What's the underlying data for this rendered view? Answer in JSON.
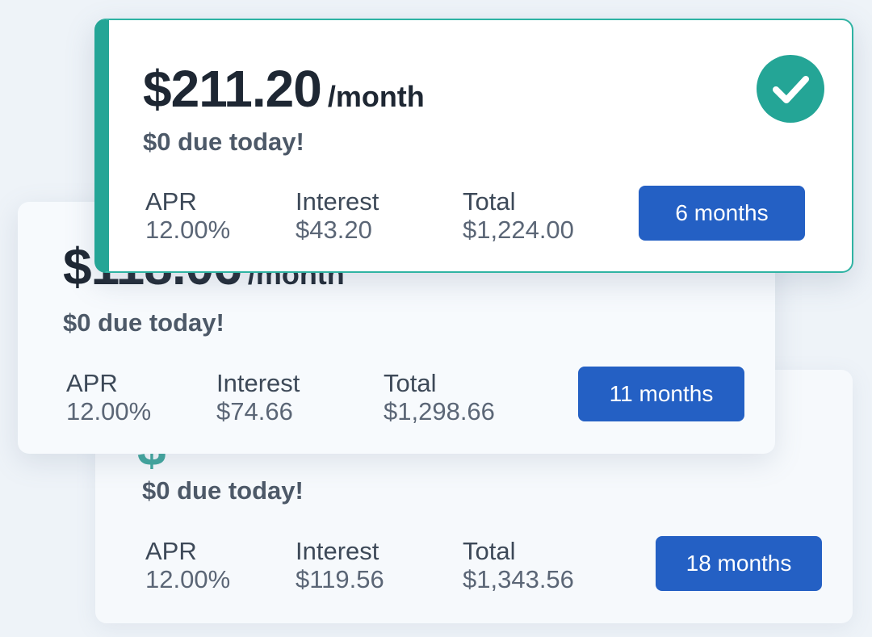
{
  "accent_color": "#24a596",
  "button_color": "#2460c4",
  "plans": [
    {
      "price": "$211.20",
      "per": "/month",
      "due": "$0 due today!",
      "apr_label": "APR",
      "apr_value": "12.00%",
      "interest_label": "Interest",
      "interest_value": "$43.20",
      "total_label": "Total",
      "total_value": "$1,224.00",
      "term": "6 months",
      "selected": true,
      "icon": "checkmark-circle-icon"
    },
    {
      "price": "$118.06",
      "per": "/month",
      "due": "$0 due today!",
      "apr_label": "APR",
      "apr_value": "12.00%",
      "interest_label": "Interest",
      "interest_value": "$74.66",
      "total_label": "Total",
      "total_value": "$1,298.66",
      "term": "11 months",
      "selected": false
    },
    {
      "due": "$0 due today!",
      "apr_label": "APR",
      "apr_value": "12.00%",
      "interest_label": "Interest",
      "interest_value": "$119.56",
      "total_label": "Total",
      "total_value": "$1,343.56",
      "term": "18 months",
      "selected": false
    }
  ]
}
